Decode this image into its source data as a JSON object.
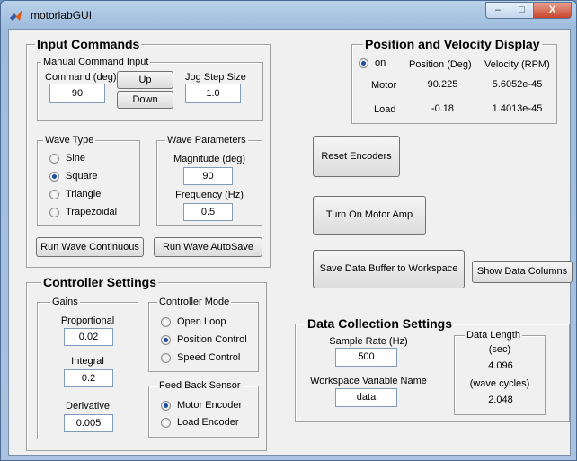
{
  "window": {
    "title": "motorlabGUI",
    "controls": {
      "minimize": "–",
      "maximize": "□",
      "close": "X"
    }
  },
  "input_commands": {
    "title": "Input Commands",
    "manual": {
      "title": "Manual Command Input",
      "command_label": "Command (deg)",
      "command_value": "90",
      "up": "Up",
      "down": "Down",
      "jog_label": "Jog Step Size",
      "jog_value": "1.0"
    },
    "wave_type": {
      "title": "Wave Type",
      "options": [
        "Sine",
        "Square",
        "Triangle",
        "Trapezoidal"
      ],
      "selected": "Square"
    },
    "wave_params": {
      "title": "Wave Parameters",
      "magnitude_label": "Magnitude (deg)",
      "magnitude_value": "90",
      "frequency_label": "Frequency (Hz)",
      "frequency_value": "0.5"
    },
    "run_continuous": "Run Wave Continuous",
    "run_autosave": "Run Wave AutoSave"
  },
  "display": {
    "title": "Position and Velocity Display",
    "on_label": "on",
    "col_position": "Position (Deg)",
    "col_velocity": "Velocity (RPM)",
    "rows": [
      {
        "label": "Motor",
        "position": "90.225",
        "velocity": "5.6052e-45"
      },
      {
        "label": "Load",
        "position": "-0.18",
        "velocity": "1.4013e-45"
      }
    ]
  },
  "actions": {
    "reset_encoders": "Reset Encoders",
    "motor_amp": "Turn On Motor Amp",
    "save_buffer": "Save Data Buffer to Workspace",
    "show_columns": "Show Data Columns"
  },
  "controller": {
    "title": "Controller Settings",
    "gains": {
      "title": "Gains",
      "proportional_label": "Proportional",
      "proportional_value": "0.02",
      "integral_label": "Integral",
      "integral_value": "0.2",
      "derivative_label": "Derivative",
      "derivative_value": "0.005"
    },
    "mode": {
      "title": "Controller Mode",
      "options": [
        "Open Loop",
        "Position Control",
        "Speed Control"
      ],
      "selected": "Position Control"
    },
    "feedback": {
      "title": "Feed Back Sensor",
      "options": [
        "Motor Encoder",
        "Load Encoder"
      ],
      "selected": "Motor Encoder"
    }
  },
  "data_collection": {
    "title": "Data Collection Settings",
    "sample_rate_label": "Sample Rate (Hz)",
    "sample_rate_value": "500",
    "workspace_var_label": "Workspace Variable Name",
    "workspace_var_value": "data",
    "length": {
      "title": "Data Length",
      "sec_label": "(sec)",
      "sec_value": "4.096",
      "cycles_label": "(wave cycles)",
      "cycles_value": "2.048"
    }
  },
  "colors": {
    "selected_radio": "#1b4e9c",
    "title_bar": "#b9d1ea",
    "panel_bg": "#f0f0f0",
    "close_button": "#c9442c"
  }
}
